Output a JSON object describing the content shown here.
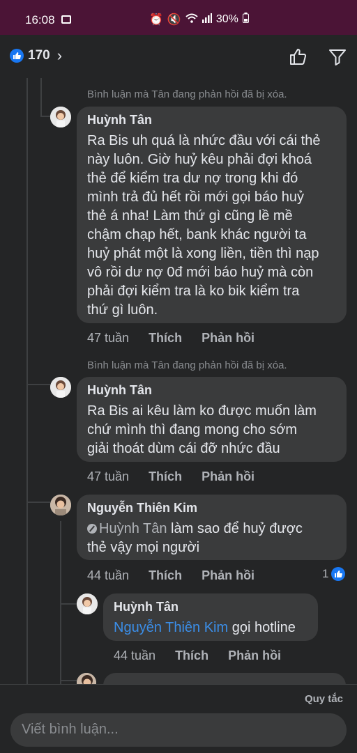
{
  "status_bar": {
    "time": "16:08",
    "battery": "30%",
    "icons": [
      "gallery-icon",
      "alarm-icon",
      "mute-icon",
      "wifi-icon",
      "signal-icon",
      "battery-icon"
    ]
  },
  "header": {
    "reaction_count": "170",
    "icons": [
      "like-icon",
      "chevron-right-icon",
      "thumbs-up-outline-icon",
      "filter-icon"
    ]
  },
  "comments": [
    {
      "deleted_notice": "Bình luận mà Tân đang phản hồi đã bị xóa.",
      "author": "Huỳnh Tân",
      "lines": [
        "Ra Bis uh quá là nhức đầu với cái thẻ",
        "này luôn. Giờ huỷ kêu phải đợi khoá",
        "thẻ để kiểm tra dư nợ trong khi đó",
        "mình trả đủ hết rồi mới gọi báo huỷ",
        "thẻ á nha! Làm thứ gì cũng lề mề",
        "chậm chạp hết, bank khác người ta",
        "huỷ phát một là xong liền, tiền thì nạp",
        "vô rồi dư nợ 0đ mới báo huỷ mà còn",
        "phải đợi kiểm tra là ko bik kiểm tra",
        "thứ gì luôn."
      ],
      "time": "47 tuần",
      "like": "Thích",
      "reply": "Phản hồi"
    },
    {
      "deleted_notice": "Bình luận mà Tân đang phản hồi đã bị xóa.",
      "author": "Huỳnh Tân",
      "lines": [
        "Ra Bis ai kêu làm ko được muốn làm",
        "chứ mình thì đang mong cho sớm",
        "giải thoát dùm cái đỡ nhức đầu"
      ],
      "time": "47 tuần",
      "like": "Thích",
      "reply": "Phản hồi"
    },
    {
      "author": "Nguyễn Thiên Kim",
      "mention": "Huỳnh Tân",
      "lines": [
        " làm sao để huỷ được",
        "thẻ vậy mọi người"
      ],
      "time": "44 tuần",
      "like": "Thích",
      "reply": "Phản hồi",
      "reaction_count": "1"
    },
    {
      "author": "Huỳnh Tân",
      "mention": "Nguyễn Thiên Kim",
      "lines": [
        " gọi hotline"
      ],
      "time": "44 tuần",
      "like": "Thích",
      "reply": "Phản hồi"
    }
  ],
  "footer": {
    "rules_label": "Quy tắc",
    "composer_placeholder": "Viết bình luận..."
  },
  "colors": {
    "background": "#242526",
    "bubble": "#3a3b3c",
    "status_bar": "#4b1436",
    "accent": "#1877f2",
    "mention": "#3b8ee8"
  }
}
